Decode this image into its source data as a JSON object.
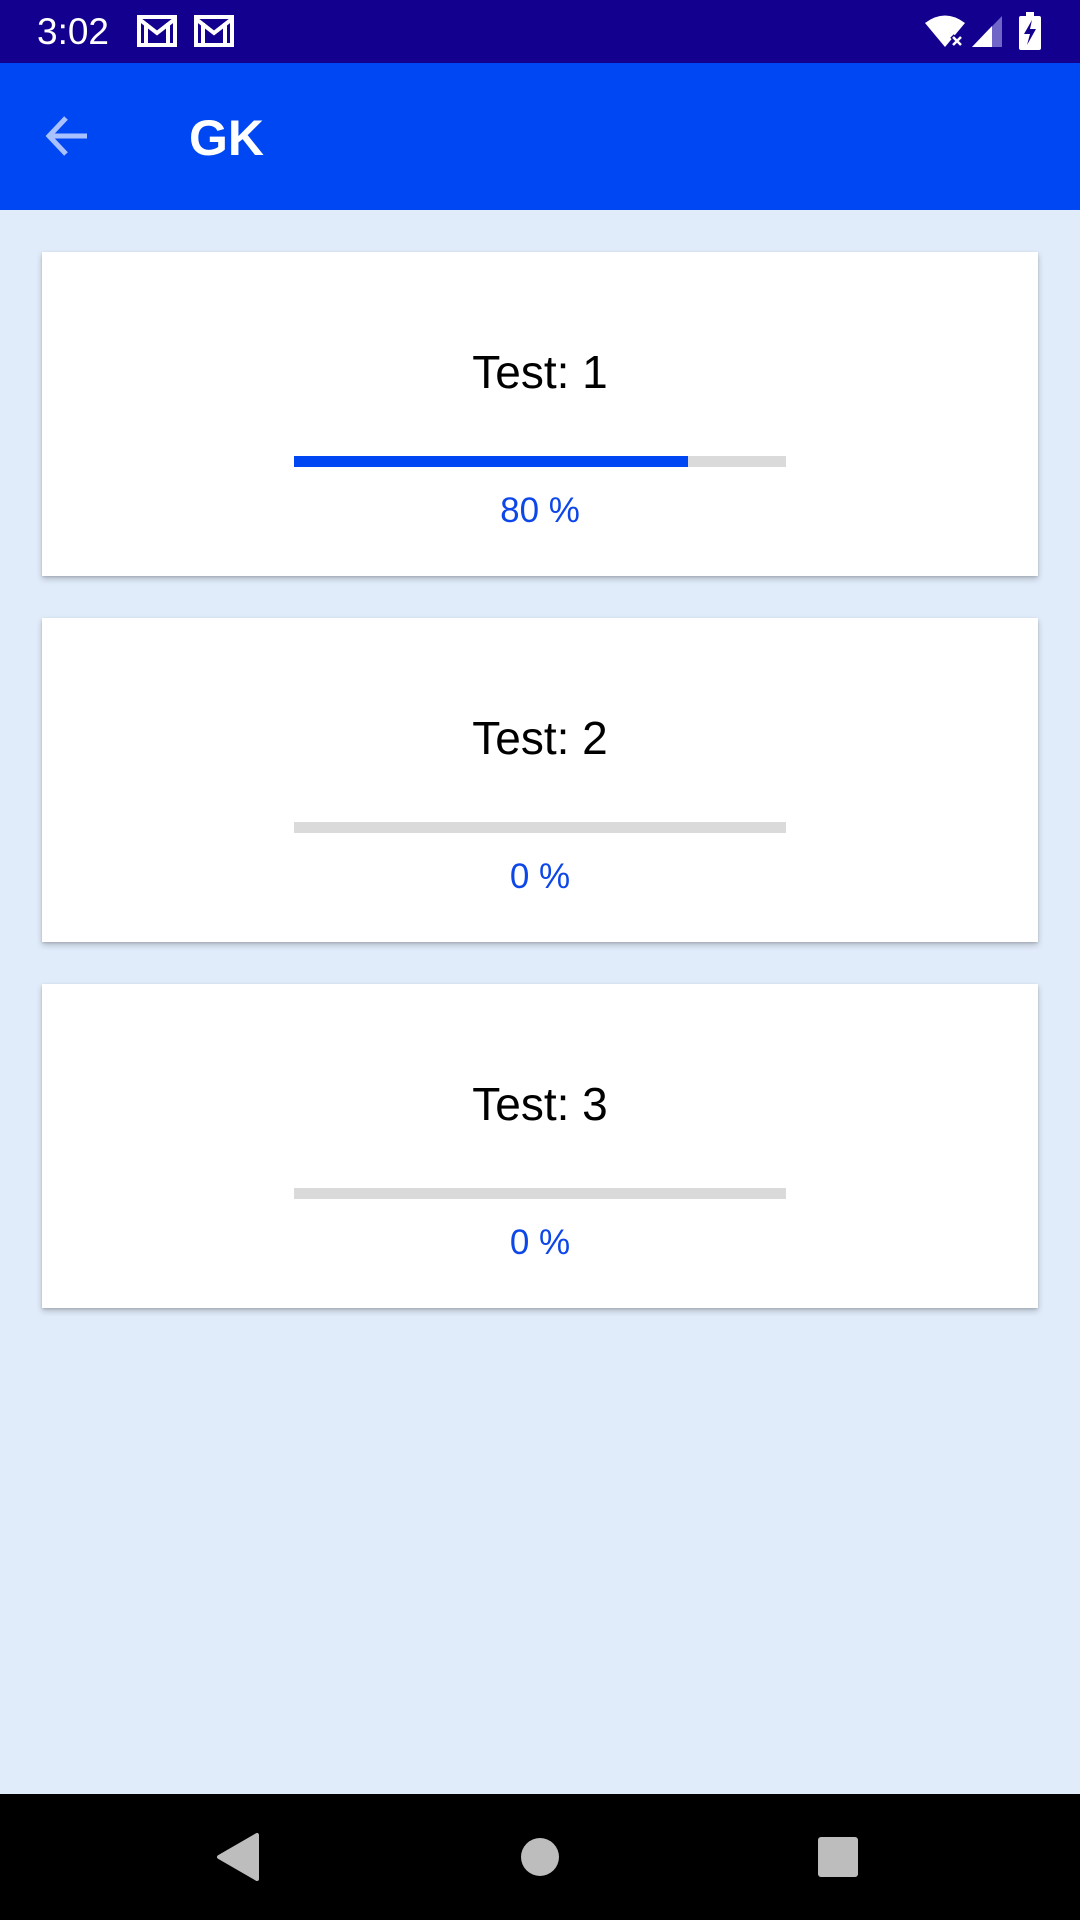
{
  "status_bar": {
    "time": "3:02",
    "notification_icons": [
      "gmail-icon",
      "gmail-icon"
    ],
    "wifi_icon": "wifi-off-icon",
    "signal_icon": "signal-icon",
    "battery_icon": "battery-charging-icon"
  },
  "app_bar": {
    "title": "GK",
    "back_icon": "arrow-back-icon",
    "color": "#0047f4"
  },
  "tests": [
    {
      "title": "Test: 1",
      "progress": 80,
      "progress_label": "80 %"
    },
    {
      "title": "Test: 2",
      "progress": 0,
      "progress_label": "0 %"
    },
    {
      "title": "Test: 3",
      "progress": 0,
      "progress_label": "0 %"
    }
  ],
  "colors": {
    "status_bar": "#14008f",
    "background": "#e1ecfb",
    "progress_fill": "#0047f4",
    "progress_track": "#dadada",
    "progress_text": "#0d47e8"
  }
}
